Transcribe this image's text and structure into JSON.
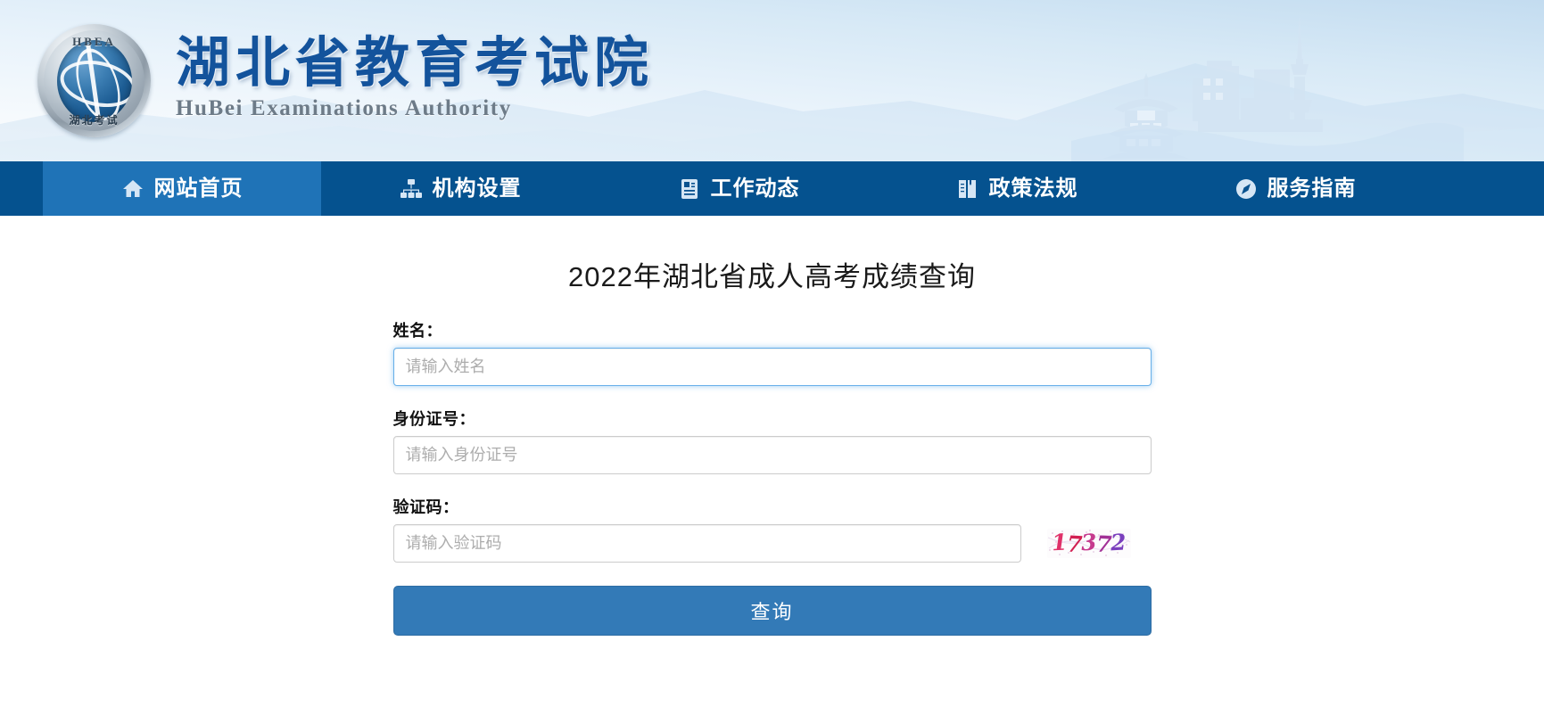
{
  "site": {
    "logo": {
      "emblem_top_text": "HBEA",
      "emblem_bottom_text": "湖北考试",
      "name_cn": "湖北省教育考试院",
      "name_en": "HuBei Examinations Authority",
      "icon": "hubei-examinations-authority-emblem"
    },
    "banner_decor": {
      "pagoda": "yellow-crane-tower-silhouette",
      "tower": "tv-tower-silhouette",
      "buildings": "city-buildings-silhouette",
      "mountains": "mountain-range-silhouette"
    }
  },
  "nav": {
    "active_index": 0,
    "active_bg": "#1f73b7",
    "bar_bg": "#05528f",
    "items": [
      {
        "label": "网站首页",
        "icon": "home-icon"
      },
      {
        "label": "机构设置",
        "icon": "sitemap-icon"
      },
      {
        "label": "工作动态",
        "icon": "news-document-icon"
      },
      {
        "label": "政策法规",
        "icon": "book-icon"
      },
      {
        "label": "服务指南",
        "icon": "compass-icon"
      }
    ]
  },
  "main": {
    "title": "2022年湖北省成人高考成绩查询",
    "fields": [
      {
        "key": "name",
        "label": "姓名：",
        "placeholder": "请输入姓名",
        "value": "",
        "focused": true
      },
      {
        "key": "id_number",
        "label": "身份证号：",
        "placeholder": "请输入身份证号",
        "value": "",
        "focused": false
      },
      {
        "key": "captcha",
        "label": "验证码：",
        "placeholder": "请输入验证码",
        "value": "",
        "focused": false
      }
    ],
    "captcha": {
      "code": "17372",
      "digits": [
        {
          "char": "1",
          "color": "#e0316a"
        },
        {
          "char": "7",
          "color": "#d21f52"
        },
        {
          "char": "3",
          "color": "#c63a8e"
        },
        {
          "char": "7",
          "color": "#a23196"
        },
        {
          "char": "2",
          "color": "#7a3fbd"
        }
      ],
      "alt": "captcha-image"
    },
    "submit_label": "查询",
    "submit_color": "#337ab7"
  }
}
